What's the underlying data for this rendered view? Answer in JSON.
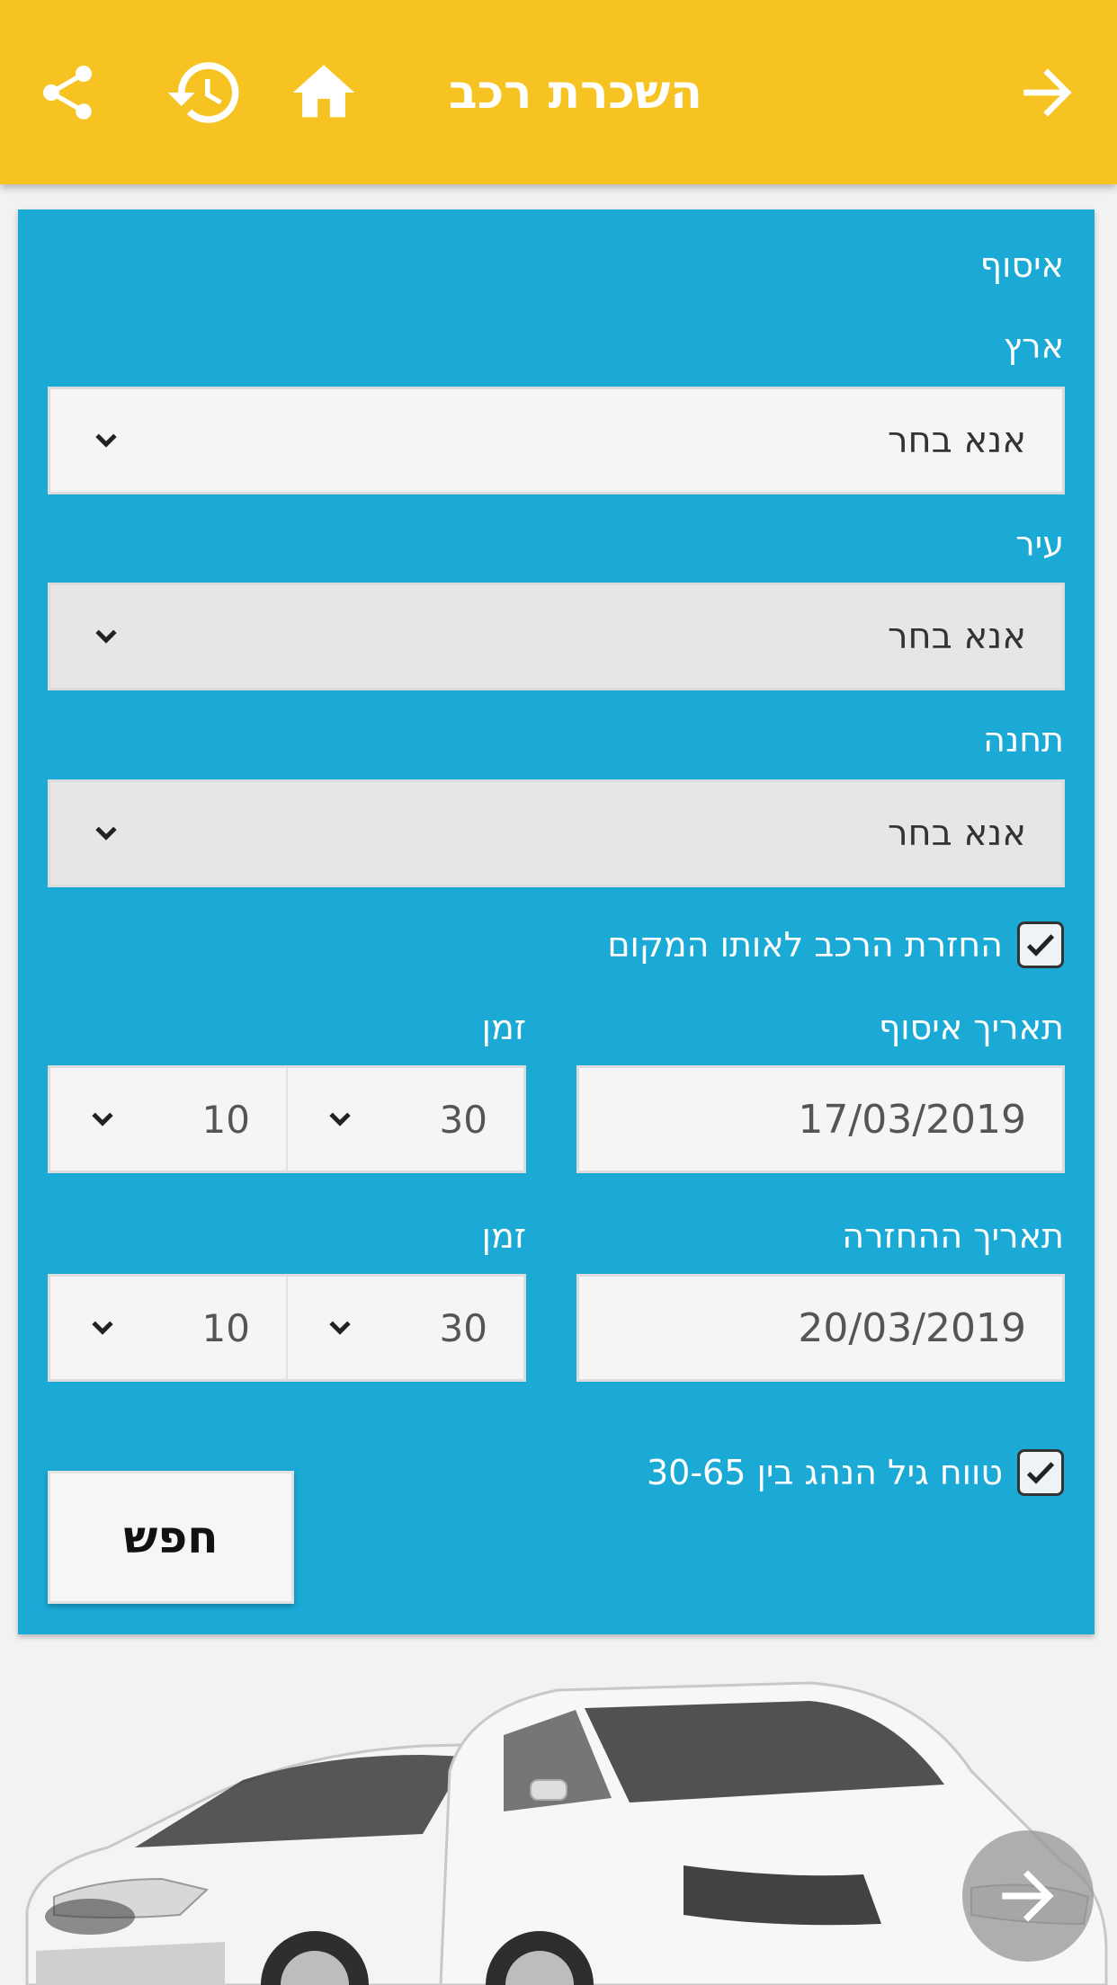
{
  "header": {
    "title": "השכרת רכב",
    "icons": [
      "share-icon",
      "history-icon",
      "home-icon",
      "arrow-right-icon"
    ],
    "bg_color": "#f6c322"
  },
  "form": {
    "section_title": "איסוף",
    "country": {
      "label": "ארץ",
      "value": "אנא בחר"
    },
    "city": {
      "label": "עיר",
      "value": "אנא בחר"
    },
    "station": {
      "label": "תחנה",
      "value": "אנא בחר"
    },
    "same_place_return": {
      "label": "החזרת הרכב לאותו המקום",
      "checked": true
    },
    "pickup": {
      "date_label": "תאריך איסוף",
      "date_value": "17/03/2019",
      "time_label": "זמן",
      "hour": "10",
      "minute": "30"
    },
    "return": {
      "date_label": "תאריך ההחזרה",
      "date_value": "20/03/2019",
      "time_label": "זמן",
      "hour": "10",
      "minute": "30"
    },
    "driver_age": {
      "label": "טווח גיל הנהג בין 30-65",
      "checked": true
    },
    "search_label": "חפש",
    "panel_color": "#1ba9d6"
  },
  "fab": {
    "icon": "arrow-right-icon"
  }
}
